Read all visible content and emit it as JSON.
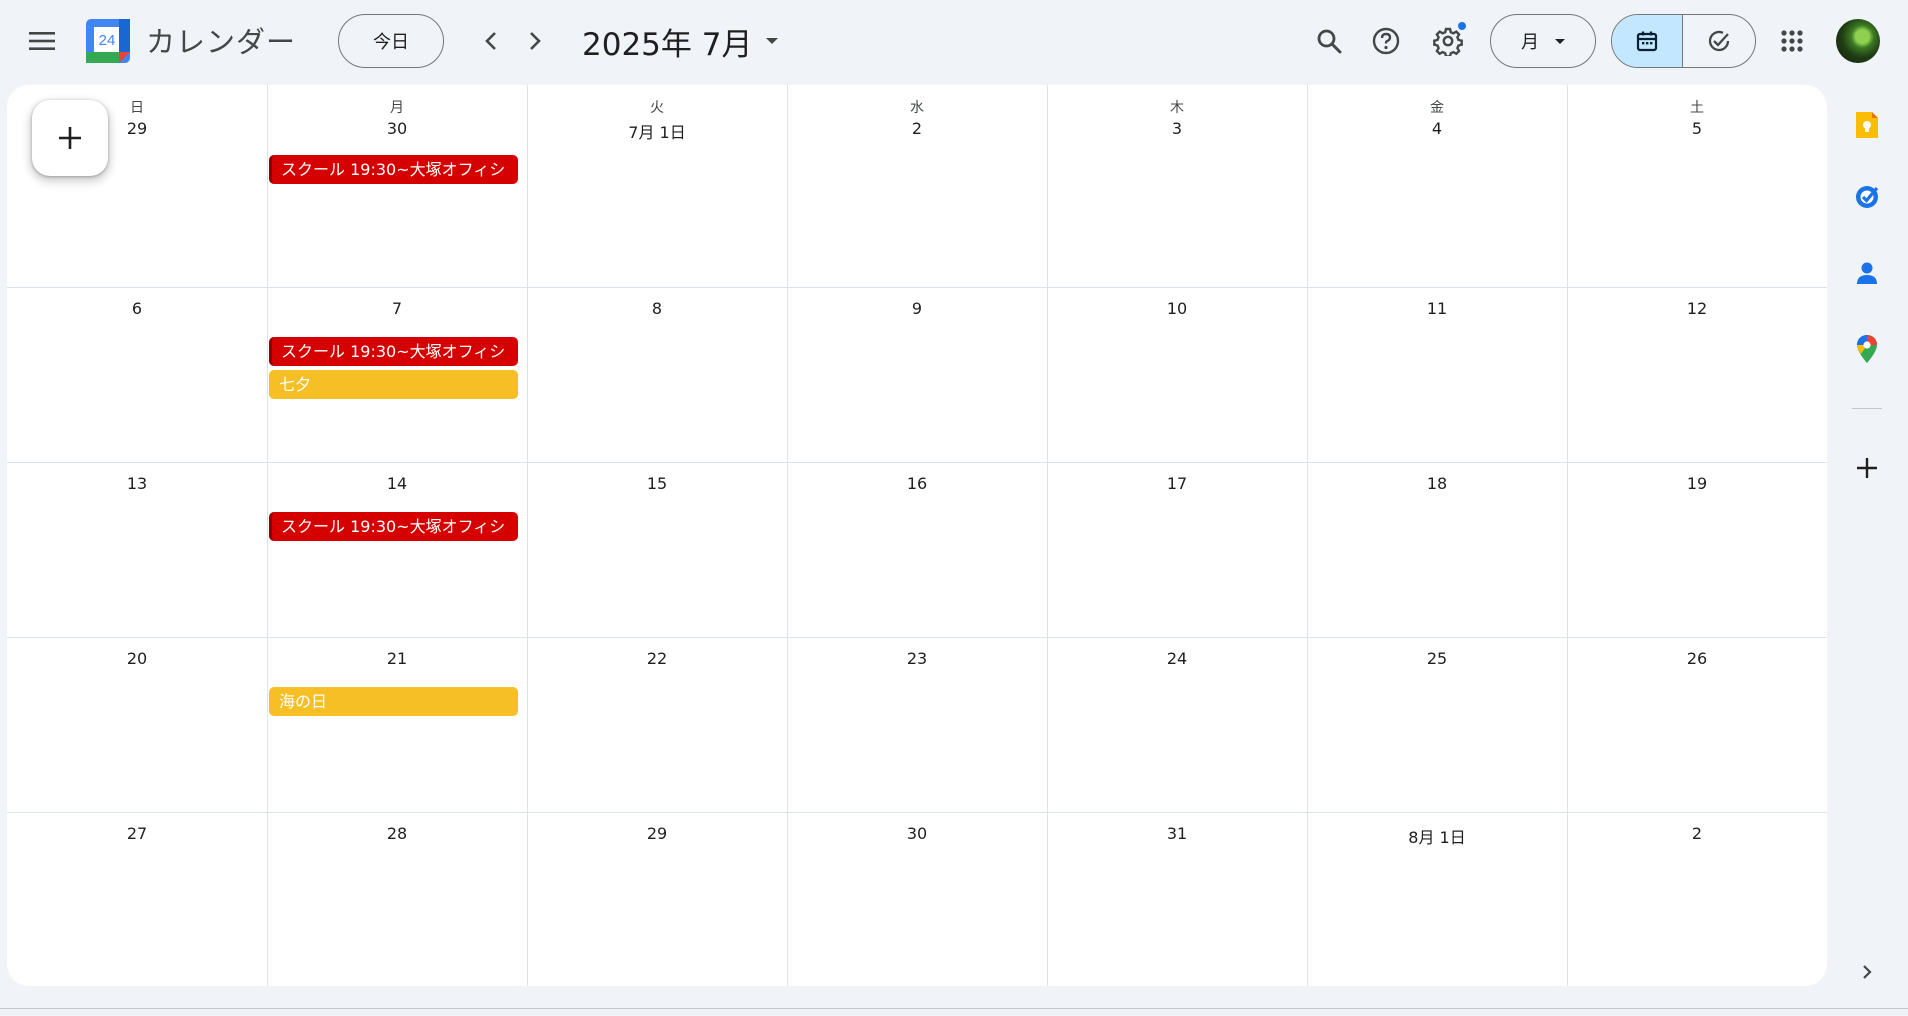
{
  "header": {
    "menu_icon": "hamburger-menu-icon",
    "logo_number": "24",
    "app_title": "カレンダー",
    "today_label": "今日",
    "date_title": "2025年 7月",
    "view_label": "月"
  },
  "weekdays": [
    "日",
    "月",
    "火",
    "水",
    "木",
    "金",
    "土"
  ],
  "weeks": [
    [
      "29",
      "30",
      "7月 1日",
      "2",
      "3",
      "4",
      "5"
    ],
    [
      "6",
      "7",
      "8",
      "9",
      "10",
      "11",
      "12"
    ],
    [
      "13",
      "14",
      "15",
      "16",
      "17",
      "18",
      "19"
    ],
    [
      "20",
      "21",
      "22",
      "23",
      "24",
      "25",
      "26"
    ],
    [
      "27",
      "28",
      "29",
      "30",
      "31",
      "8月 1日",
      "2"
    ]
  ],
  "events": [
    {
      "week": 0,
      "day": 1,
      "slot": 0,
      "title": "スクール 19:30~大塚オフィシ",
      "color": "red"
    },
    {
      "week": 1,
      "day": 1,
      "slot": 0,
      "title": "スクール 19:30~大塚オフィシ",
      "color": "red"
    },
    {
      "week": 1,
      "day": 1,
      "slot": 1,
      "title": "七夕",
      "color": "yellow"
    },
    {
      "week": 2,
      "day": 1,
      "slot": 0,
      "title": "スクール 19:30~大塚オフィシ",
      "color": "red"
    },
    {
      "week": 3,
      "day": 1,
      "slot": 0,
      "title": "海の日",
      "color": "yellow"
    }
  ],
  "colors": {
    "background": "#f0f4f9",
    "accent": "#1a73e8",
    "selected_toggle": "#c2e7ff",
    "event_red": "#d50000",
    "event_yellow": "#f6bf26"
  },
  "side_panel": [
    "keep-icon",
    "tasks-icon",
    "contacts-icon",
    "maps-icon",
    "add-icon",
    "chevron-right-icon"
  ]
}
